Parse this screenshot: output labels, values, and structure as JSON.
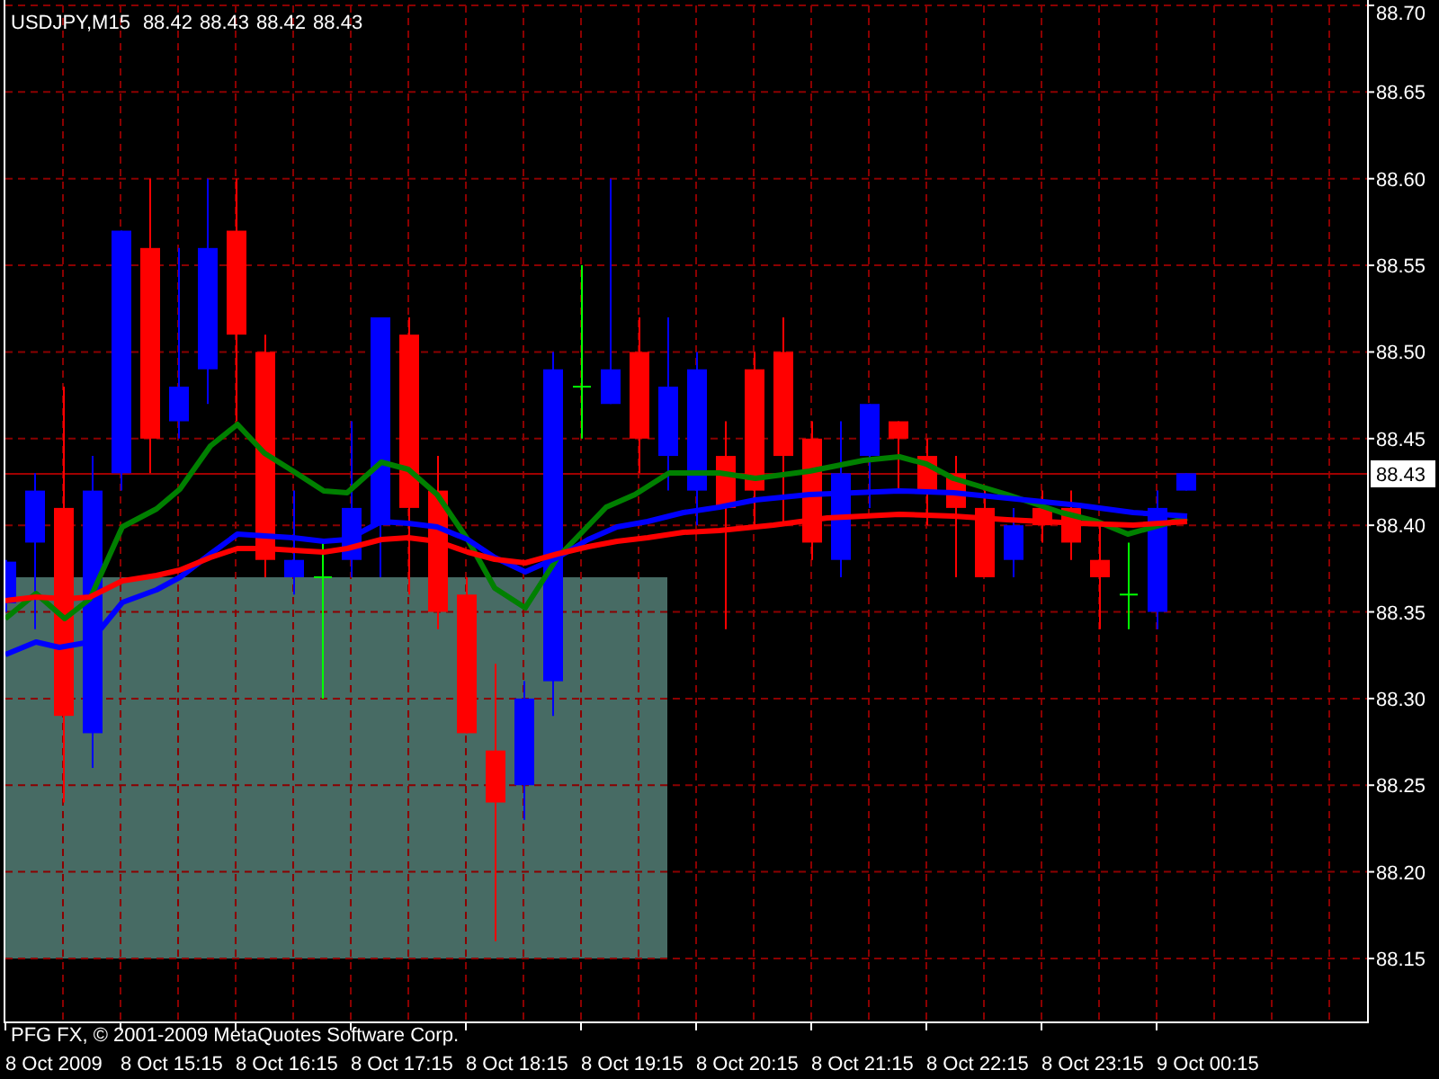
{
  "chart_header": {
    "symbol": "USDJPY,M15",
    "quotes": [
      "88.42",
      "88.43",
      "88.42",
      "88.43"
    ]
  },
  "price_axis": {
    "labels": [
      "88.70",
      "88.65",
      "88.60",
      "88.55",
      "88.50",
      "88.45",
      "88.40",
      "88.35",
      "88.30",
      "88.25",
      "88.20",
      "88.15"
    ],
    "current_price": "88.43"
  },
  "time_axis": {
    "labels": [
      "8 Oct 2009",
      "8 Oct 15:15",
      "8 Oct 16:15",
      "8 Oct 17:15",
      "8 Oct 18:15",
      "8 Oct 19:15",
      "8 Oct 20:15",
      "8 Oct 21:15",
      "8 Oct 22:15",
      "8 Oct 23:15",
      "9 Oct 00:15"
    ]
  },
  "copyright": "PFG FX, © 2001-2009 MetaQuotes Software Corp."
}
